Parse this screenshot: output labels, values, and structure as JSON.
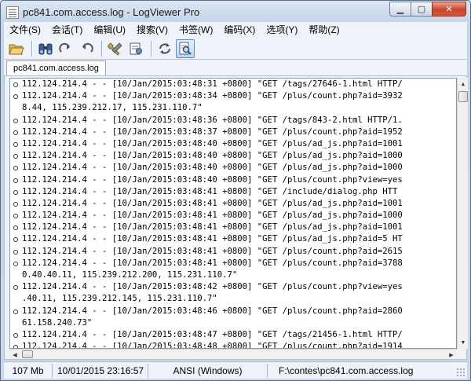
{
  "window": {
    "title": "pc841.com.access.log - LogViewer Pro",
    "controls": {
      "minimize": "▁",
      "maximize": "▢",
      "close": "✕"
    }
  },
  "menu": {
    "items": [
      {
        "label": "文件(S)"
      },
      {
        "label": "会话(T)"
      },
      {
        "label": "编辑(U)"
      },
      {
        "label": "搜索(V)"
      },
      {
        "label": "书签(W)"
      },
      {
        "label": "编码(X)"
      },
      {
        "label": "选项(Y)"
      },
      {
        "label": "帮助(Z)"
      }
    ]
  },
  "toolbar": {
    "buttons": [
      {
        "icon": "folder-open-icon"
      },
      {
        "icon": "binoculars-icon"
      },
      {
        "icon": "redo-icon"
      },
      {
        "icon": "undo-icon"
      },
      {
        "icon": "tools-icon"
      },
      {
        "icon": "properties-icon"
      },
      {
        "icon": "refresh-icon"
      },
      {
        "icon": "find-document-icon",
        "active": true
      }
    ]
  },
  "tabs": [
    {
      "label": "pc841.com.access.log"
    }
  ],
  "log": {
    "lines": [
      "112.124.214.4 - - [10/Jan/2015:03:48:31 +0800] \"GET /tags/27646-1.html HTTP/",
      "112.124.214.4 - - [10/Jan/2015:03:48:34 +0800] \"GET /plus/count.php?aid=3932",
      "8.44, 115.239.212.17, 115.231.110.7\"",
      "112.124.214.4 - - [10/Jan/2015:03:48:36 +0800] \"GET /tags/843-2.html HTTP/1.",
      "112.124.214.4 - - [10/Jan/2015:03:48:37 +0800] \"GET /plus/count.php?aid=1952",
      "112.124.214.4 - - [10/Jan/2015:03:48:40 +0800] \"GET /plus/ad_js.php?aid=1001",
      "112.124.214.4 - - [10/Jan/2015:03:48:40 +0800] \"GET /plus/ad_js.php?aid=1000",
      "112.124.214.4 - - [10/Jan/2015:03:48:40 +0800] \"GET /plus/ad_js.php?aid=1000",
      "112.124.214.4 - - [10/Jan/2015:03:48:40 +0800] \"GET /plus/count.php?view=yes",
      "112.124.214.4 - - [10/Jan/2015:03:48:41 +0800] \"GET /include/dialog.php HTT",
      "112.124.214.4 - - [10/Jan/2015:03:48:41 +0800] \"GET /plus/ad_js.php?aid=1001",
      "112.124.214.4 - - [10/Jan/2015:03:48:41 +0800] \"GET /plus/ad_js.php?aid=1000",
      "112.124.214.4 - - [10/Jan/2015:03:48:41 +0800] \"GET /plus/ad_js.php?aid=1001",
      "112.124.214.4 - - [10/Jan/2015:03:48:41 +0800] \"GET /plus/ad_js.php?aid=5 HT",
      "112.124.214.4 - - [10/Jan/2015:03:48:41 +0800] \"GET /plus/count.php?aid=2615",
      "112.124.214.4 - - [10/Jan/2015:03:48:41 +0800] \"GET /plus/count.php?aid=3788",
      "0.40.40.11, 115.239.212.200, 115.231.110.7\"",
      "112.124.214.4 - - [10/Jan/2015:03:48:42 +0800] \"GET /plus/count.php?view=yes",
      ".40.11, 115.239.212.145, 115.231.110.7\"",
      "112.124.214.4 - - [10/Jan/2015:03:48:46 +0800] \"GET /plus/count.php?aid=2860",
      "61.158.240.73\"",
      "112.124.214.4 - - [10/Jan/2015:03:48:47 +0800] \"GET /tags/21456-1.html HTTP/",
      "112.124.214.4 - - [10/Jan/2015:03:48:48 +0800] \"GET /plus/count.php?aid=1914"
    ],
    "bullets": [
      true,
      true,
      false,
      true,
      true,
      true,
      true,
      true,
      true,
      true,
      true,
      true,
      true,
      true,
      true,
      true,
      false,
      true,
      false,
      true,
      false,
      true,
      true
    ]
  },
  "status": {
    "size": "107 Mb",
    "modified": "10/01/2015 23:16:57",
    "encoding": "ANSI (Windows)",
    "path": "F:\\contes\\pc841.com.access.log"
  }
}
